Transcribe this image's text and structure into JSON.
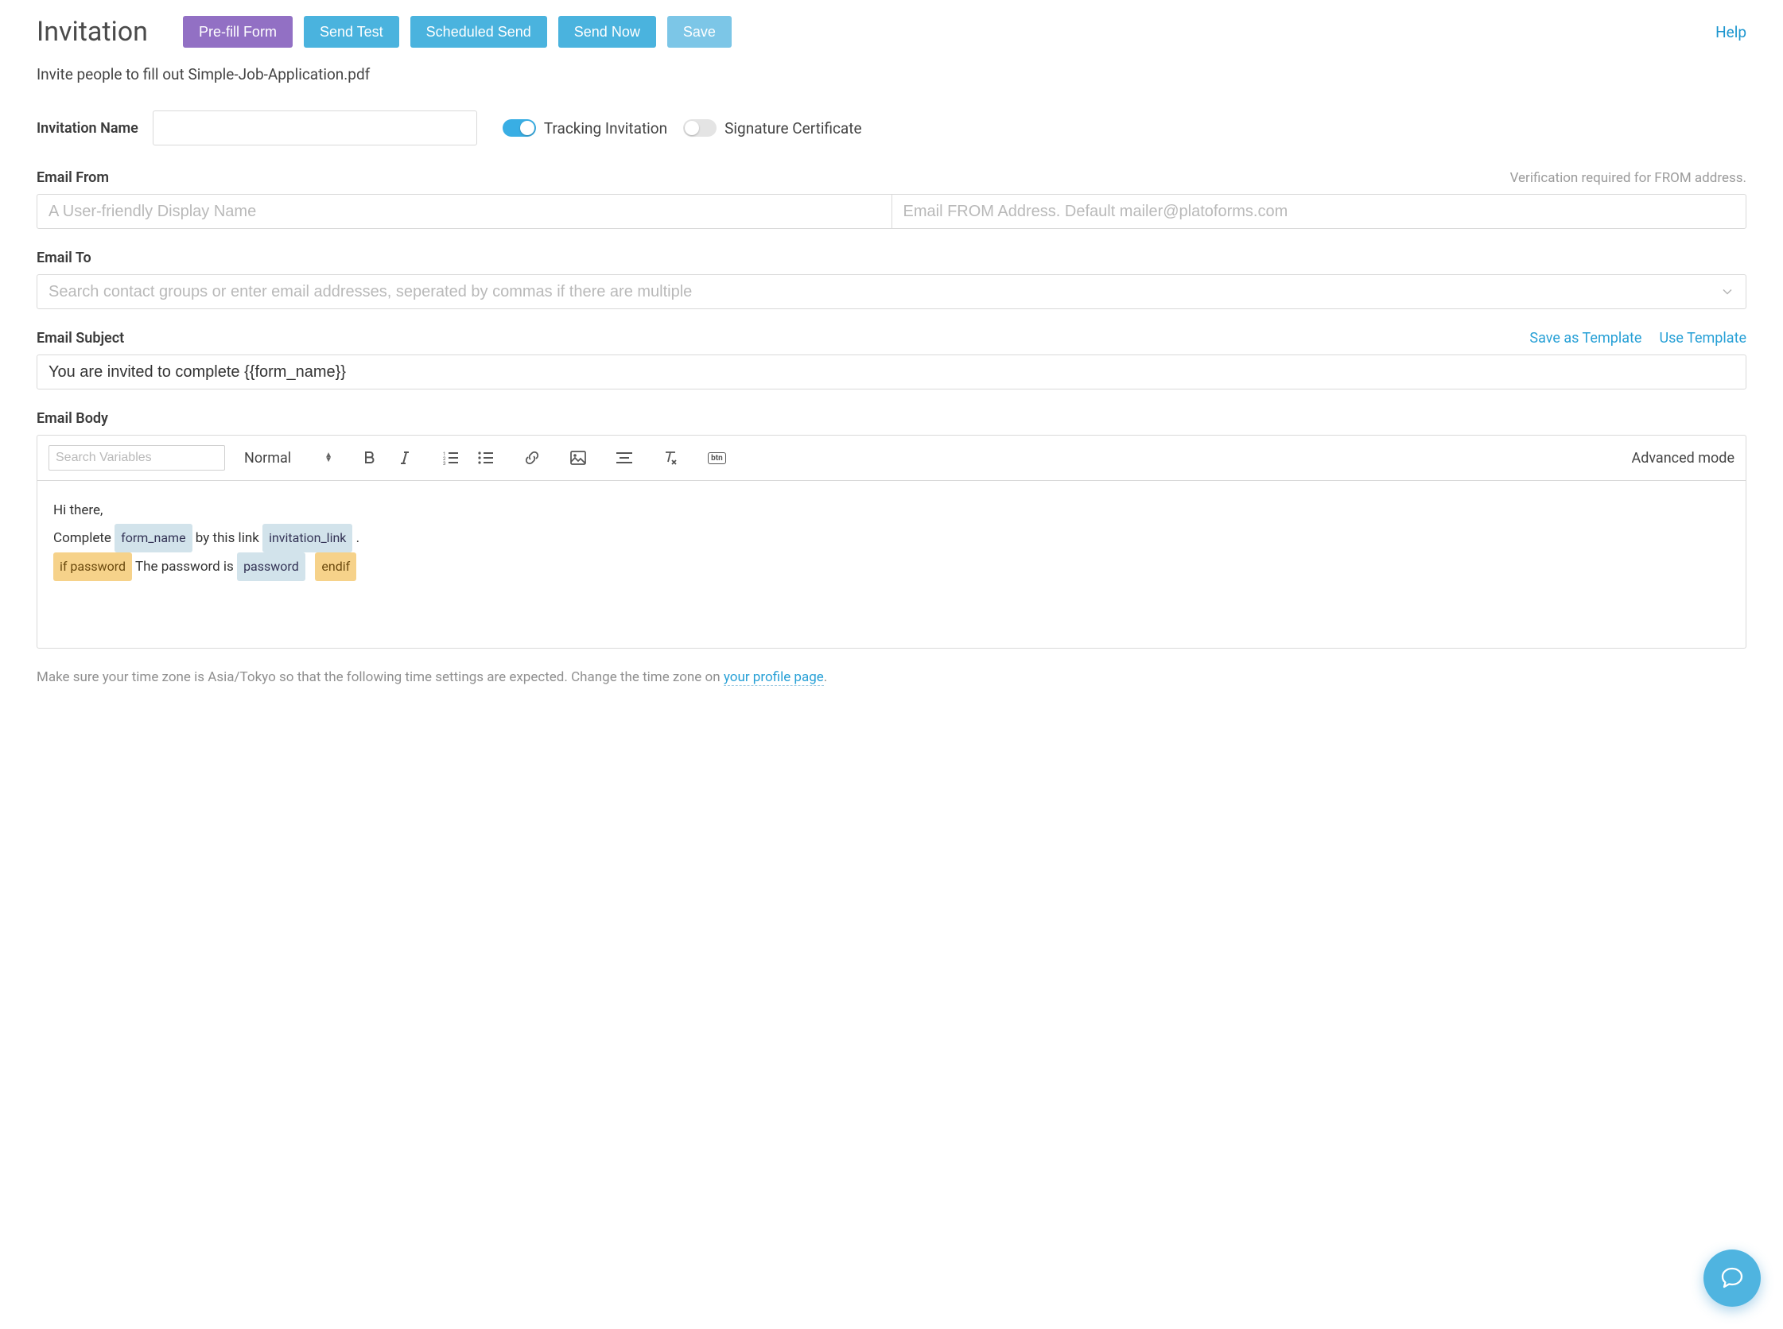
{
  "header": {
    "title": "Invitation",
    "buttons": {
      "prefill": "Pre-fill Form",
      "sendTest": "Send Test",
      "scheduled": "Scheduled Send",
      "sendNow": "Send Now",
      "save": "Save"
    },
    "help": "Help"
  },
  "subtitle": "Invite people to fill out Simple-Job-Application.pdf",
  "invitationName": {
    "label": "Invitation Name",
    "value": ""
  },
  "toggles": {
    "tracking": "Tracking Invitation",
    "signature": "Signature Certificate"
  },
  "emailFrom": {
    "label": "Email From",
    "note": "Verification required for FROM address.",
    "displayPlaceholder": "A User-friendly Display Name",
    "addressPlaceholder": "Email FROM Address. Default mailer@platoforms.com"
  },
  "emailTo": {
    "label": "Email To",
    "placeholder": "Search contact groups or enter email addresses, seperated by commas if there are multiple"
  },
  "emailSubject": {
    "label": "Email Subject",
    "value": "You are invited to complete {{form_name}}",
    "saveTemplate": "Save as Template",
    "useTemplate": "Use Template"
  },
  "emailBody": {
    "label": "Email Body",
    "searchPlaceholder": "Search Variables",
    "formatLabel": "Normal",
    "advancedMode": "Advanced mode",
    "btnBadge": "btn"
  },
  "body": {
    "line1": "Hi there,",
    "line2a": "Complete ",
    "pill1": "form_name",
    "line2b": " by this link ",
    "pill2": "invitation_link",
    "line2c": "  .",
    "pill3": "if password",
    "line3a": " The password is ",
    "pill4": "password",
    "pill5": "endif"
  },
  "tz": {
    "a": "Make sure your time zone is Asia/Tokyo so that the following time settings are expected. Change the time zone on ",
    "link": "your profile page",
    "b": "."
  }
}
